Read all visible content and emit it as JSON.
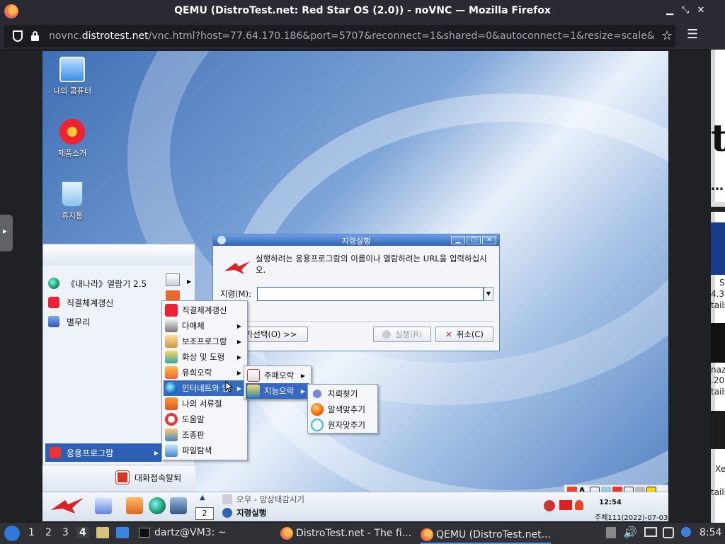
{
  "browser": {
    "window_title": "QEMU (DistroTest.net: Red Star OS (2.0)) - noVNC — Mozilla Firefox",
    "url_prefix": "novnc.",
    "url_domain": "distrotest.net",
    "url_rest": "/vnc.html?host=77.64.170.186&port=5707&reconnect=1&shared=0&autoconnect=1&resize=scale&"
  },
  "desktop": {
    "icons": [
      {
        "label": "나의 콤퓨터"
      },
      {
        "label": "제품소개"
      },
      {
        "label": "휴지통"
      }
    ]
  },
  "start_menu": {
    "items": [
      {
        "label": "《내나라》열람기 2.5"
      },
      {
        "label": "직결체계갱신"
      },
      {
        "label": "별무리"
      }
    ],
    "applications_label": "응용프로그람",
    "logout_label": "대화접속탈퇴"
  },
  "apps_menu": {
    "items": [
      {
        "label": "직결체계갱신"
      },
      {
        "label": "다매체"
      },
      {
        "label": "보조프로그람"
      },
      {
        "label": "화상 및 도형"
      },
      {
        "label": "유희오락"
      },
      {
        "label": "인터네트와 망"
      },
      {
        "label": "나의 서류철"
      },
      {
        "label": "도움말"
      },
      {
        "label": "조종판"
      },
      {
        "label": "파일탐색"
      }
    ]
  },
  "games_menu": {
    "items": [
      {
        "label": "주패오락"
      },
      {
        "label": "지능오락"
      }
    ]
  },
  "puzzle_menu": {
    "items": [
      {
        "label": "지뢰찾기"
      },
      {
        "label": "알색맞추기"
      },
      {
        "label": "원자맞추기"
      }
    ]
  },
  "run_dialog": {
    "title": "지령실행",
    "message": "실행하려는 응용프로그람의 이름이나 열람하려는 URL을 입력하십시오.",
    "command_label": "지령(M):",
    "command_value": "",
    "browse_label": "가선택(O) >>",
    "run_label": "실행(R)",
    "cancel_label": "취소(C)"
  },
  "rs_taskbar": {
    "workspace": "2",
    "task_top": "오우 - 망상태감시기",
    "task_bottom": "지령실행",
    "clock": "12:54",
    "date": "주체111(2022)-07-03"
  },
  "host_panel": {
    "workspaces": [
      "1",
      "2",
      "3",
      "4"
    ],
    "active_workspace": "4",
    "terminal_label": "dartz@VM3: ~",
    "task1_label": "DistroTest.net - The fi...",
    "task2_label": "QEMU (DistroTest.net...",
    "clock": "8:54"
  },
  "side_page": {
    "letter": "t",
    "frag1": "S",
    "frag2": "4.3",
    "frag3": "tails",
    "frag4": "naz",
    "frag5": ".20",
    "frag6": "tails",
    "frag7": "Xe",
    "frag8": "tails"
  }
}
